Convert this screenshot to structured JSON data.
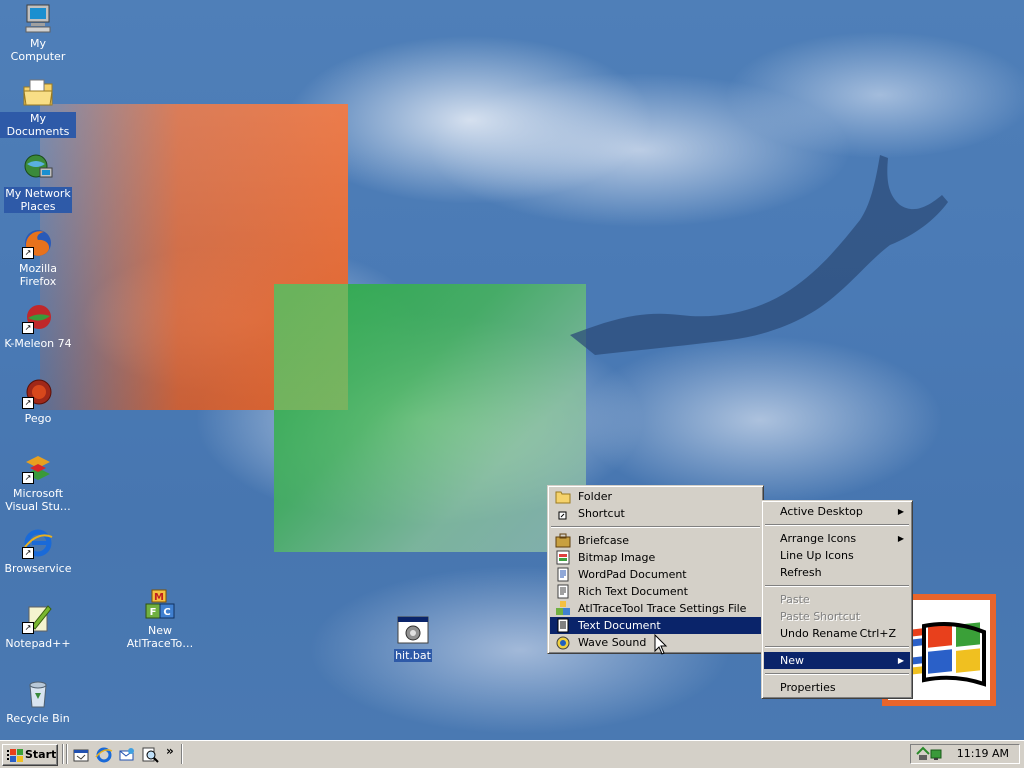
{
  "desktop_icons": [
    {
      "label": "My Computer",
      "icon": "my-computer-icon"
    },
    {
      "label": "My Documents",
      "icon": "my-documents-icon"
    },
    {
      "label": "My Network Places",
      "icon": "network-places-icon"
    },
    {
      "label": "Mozilla Firefox",
      "icon": "firefox-icon"
    },
    {
      "label": "K-Meleon 74",
      "icon": "k-meleon-icon"
    },
    {
      "label": "Pego",
      "icon": "pego-icon"
    },
    {
      "label": "Microsoft Visual Stu…",
      "icon": "visual-studio-icon"
    },
    {
      "label": "Browservice",
      "icon": "browservice-icon"
    },
    {
      "label": "Notepad++",
      "icon": "notepad-plus-plus-icon"
    },
    {
      "label": "Recycle Bin",
      "icon": "recycle-bin-icon"
    },
    {
      "label": "New AtlTraceTo…",
      "icon": "mfc-icon"
    },
    {
      "label": "hit.bat",
      "icon": "batch-file-icon"
    }
  ],
  "context_menu": {
    "items": [
      {
        "label": "Active Desktop",
        "has_submenu": true
      },
      {
        "label": "Arrange Icons",
        "has_submenu": true
      },
      {
        "label": "Line Up Icons"
      },
      {
        "label": "Refresh"
      },
      {
        "label": "Paste",
        "disabled": true
      },
      {
        "label": "Paste Shortcut",
        "disabled": true
      },
      {
        "label": "Undo Rename",
        "shortcut": "Ctrl+Z"
      },
      {
        "label": "New",
        "has_submenu": true,
        "highlighted": true
      },
      {
        "label": "Properties"
      }
    ]
  },
  "new_submenu": {
    "items": [
      {
        "label": "Folder",
        "accel": "F",
        "icon": "folder-icon"
      },
      {
        "label": "Shortcut",
        "accel": "S",
        "icon": "shortcut-icon"
      },
      {
        "label": "Briefcase",
        "icon": "briefcase-icon"
      },
      {
        "label": "Bitmap Image",
        "icon": "bitmap-icon"
      },
      {
        "label": "WordPad Document",
        "icon": "wordpad-icon"
      },
      {
        "label": "Rich Text Document",
        "icon": "rich-text-icon"
      },
      {
        "label": "AtlTraceTool Trace Settings File",
        "icon": "atltrace-icon"
      },
      {
        "label": "Text Document",
        "icon": "text-document-icon",
        "highlighted": true
      },
      {
        "label": "Wave Sound",
        "icon": "wave-sound-icon"
      }
    ]
  },
  "taskbar": {
    "start_label": "Start",
    "quick_launch": [
      "show-desktop-icon",
      "ie-icon",
      "outlook-express-icon",
      "search-icon"
    ],
    "overflow": "»",
    "clock": "11:19 AM"
  },
  "colors": {
    "highlight": "#0a246a",
    "menu_bg": "#d4d0c8",
    "orange": "#e8652c",
    "desktop_blue": "#4a7ab5"
  }
}
